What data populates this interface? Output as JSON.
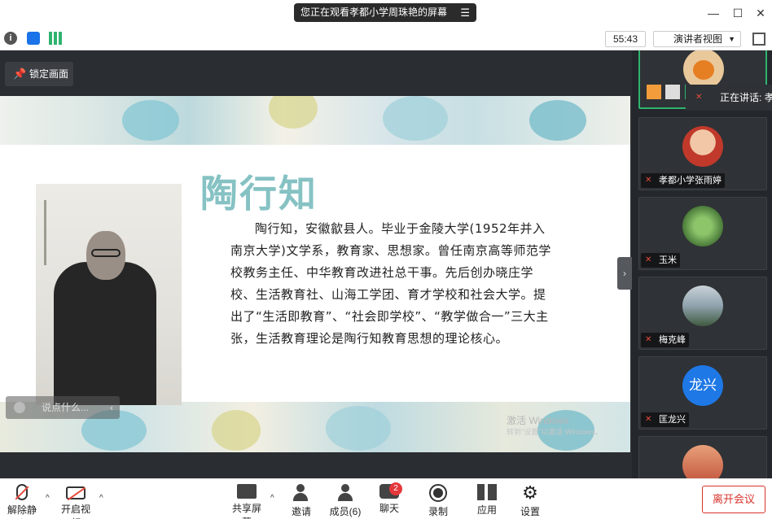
{
  "titlebar": {
    "share_notice": "您正在观看孝都小学周珠艳的屏幕",
    "menu_icon": "list-menu-icon"
  },
  "toolbar": {
    "timer": "55:43",
    "view_mode": "演讲者视图"
  },
  "share": {
    "lock_label": "锁定画面",
    "chat_placeholder": "说点什么...",
    "watermark_line1": "激活 Windows",
    "watermark_line2": "转到\"设置\"以激活 Windows。"
  },
  "slide": {
    "title": "陶行知",
    "body": "陶行知，安徽歙县人。毕业于金陵大学(1952年并入南京大学)文学系，教育家、思想家。曾任南京高等师范学校教务主任、中华教育改进社总干事。先后创办晓庄学校、生活教育社、山海工学团、育才学校和社会大学。提出了“生活即教育”、“社会即学校”、“教学做合一”三大主张，生活教育理论是陶行知教育思想的理论核心。"
  },
  "participants": {
    "speaking": "正在讲话: 孝",
    "tiles": [
      {
        "name": "孝都小学张雨婷",
        "avatar_color": "#c0392b"
      },
      {
        "name": "玉米",
        "avatar_color": "#4a7a3a"
      },
      {
        "name": "梅克峰",
        "avatar_color": "#6d7f8c"
      },
      {
        "name": "匡龙兴",
        "avatar_text": "龙兴",
        "avatar_color": "#1e78e6"
      }
    ]
  },
  "bottombar": {
    "unmute": "解除静音",
    "start_video": "开启视频",
    "share_screen": "共享屏幕",
    "invite": "邀请",
    "members": "成员(6)",
    "chat": "聊天",
    "chat_badge": "2",
    "record": "录制",
    "apps": "应用",
    "settings": "设置",
    "leave": "离开会议"
  }
}
